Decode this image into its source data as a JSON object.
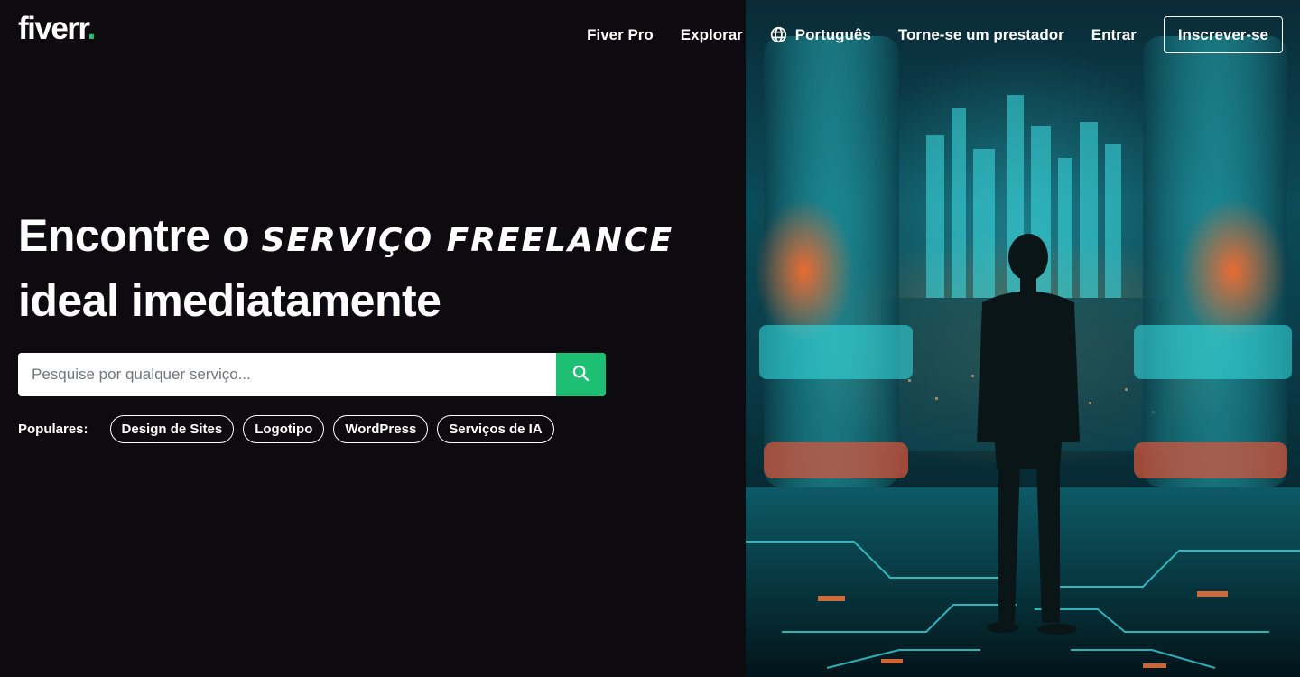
{
  "brand": {
    "logo_text": "fiverr",
    "logo_dot": ".",
    "accent_color": "#1dbf73"
  },
  "nav": {
    "fiver_pro": "Fiver Pro",
    "explore": "Explorar",
    "language": "Português",
    "become_seller": "Torne-se um prestador",
    "sign_in": "Entrar",
    "join": "Inscrever-se",
    "language_icon": "globe-icon"
  },
  "hero": {
    "title_start": "Encontre o",
    "title_accent": "serviço freelance",
    "title_end": "ideal imediatamente"
  },
  "search": {
    "placeholder": "Pesquise por qualquer serviço...",
    "button_icon": "search-icon"
  },
  "popular": {
    "label": "Populares:",
    "items": [
      "Design de Sites",
      "Logotipo",
      "WordPress",
      "Serviços de IA"
    ]
  }
}
